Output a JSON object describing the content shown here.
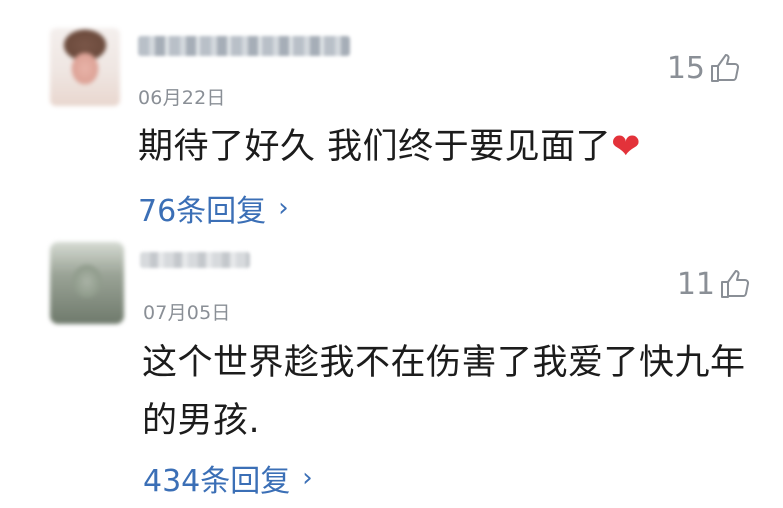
{
  "comments": [
    {
      "date": "06月22日",
      "likes": "15",
      "text": "期待了好久 我们终于要见面了",
      "emoji": "❤",
      "replies": "76条回复"
    },
    {
      "date": "07月05日",
      "likes": "11",
      "text": "这个世界趁我不在伤害了我爱了快九年的男孩.",
      "replies": "434条回复"
    }
  ],
  "icons": {
    "like": "thumbs-up-icon",
    "more": "chevron-right-icon"
  },
  "colors": {
    "link": "#3b6fb6",
    "meta": "#8a8f96",
    "heart": "#e3323a"
  }
}
